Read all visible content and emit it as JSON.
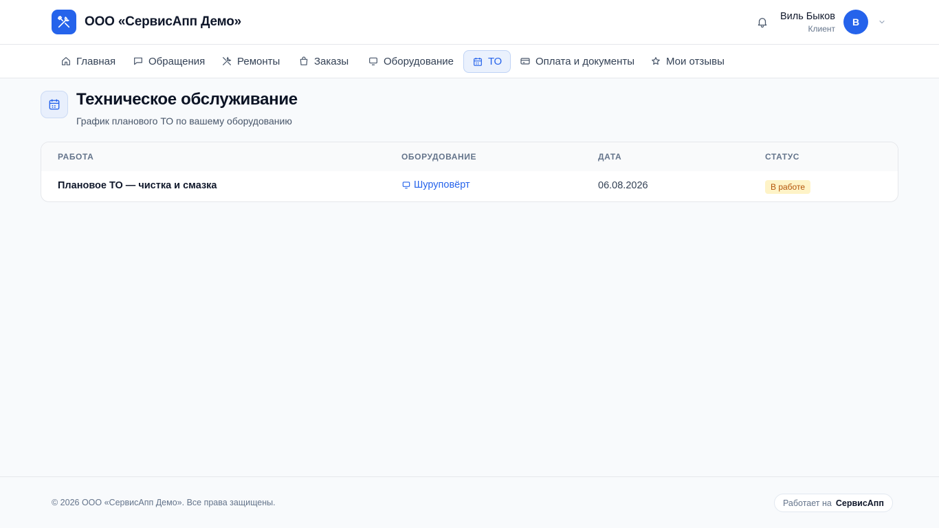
{
  "header": {
    "brand": "ООО «СервисАпп Демо»",
    "user_name": "Виль Быков",
    "user_role": "Клиент",
    "avatar_initial": "В"
  },
  "nav": [
    {
      "label": "Главная",
      "icon": "home-icon"
    },
    {
      "label": "Обращения",
      "icon": "chat-icon"
    },
    {
      "label": "Ремонты",
      "icon": "wrench-icon"
    },
    {
      "label": "Заказы",
      "icon": "bag-icon"
    },
    {
      "label": "Оборудование",
      "icon": "monitor-icon"
    },
    {
      "label": "ТО",
      "icon": "calendar-icon",
      "active": true
    },
    {
      "label": "Оплата и документы",
      "icon": "card-icon"
    },
    {
      "label": "Мои отзывы",
      "icon": "star-icon"
    }
  ],
  "page": {
    "title": "Техническое обслуживание",
    "subtitle": "График планового ТО по вашему оборудованию"
  },
  "table": {
    "columns": [
      "РАБОТА",
      "ОБОРУДОВАНИЕ",
      "ДАТА",
      "СТАТУС"
    ],
    "rows": [
      {
        "work": "Плановое ТО — чистка и смазка",
        "equipment": "Шуруповёрт",
        "date": "06.08.2026",
        "status": "В работе"
      }
    ]
  },
  "footer": {
    "copyright": "© 2026 ООО «СервисАпп Демо». Все права защищены.",
    "powered_prefix": "Работает на",
    "powered_brand": "СервисАпп"
  },
  "colors": {
    "accent": "#2563eb",
    "status_in_progress_bg": "#fef3c7",
    "status_in_progress_text": "#b45309"
  }
}
